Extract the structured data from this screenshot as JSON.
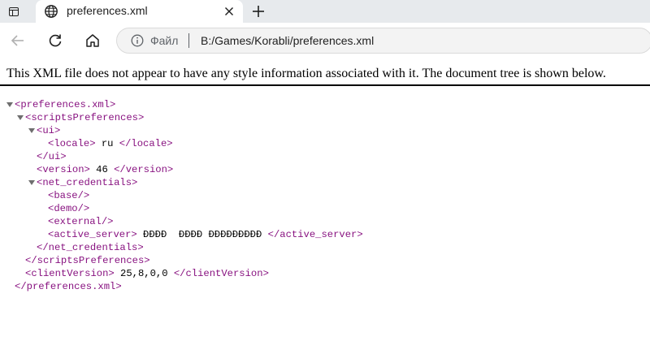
{
  "browser": {
    "tab": {
      "title": "preferences.xml",
      "icon": "globe-icon"
    },
    "toolbar": {
      "back_icon": "back-arrow-icon",
      "reload_icon": "reload-icon",
      "home_icon": "home-icon",
      "info_icon": "info-icon",
      "address_scheme_label": "Файл",
      "address_separator": "|",
      "address_url": "B:/Games/Korabli/preferences.xml"
    }
  },
  "xml_viewer": {
    "info_message": "This XML file does not appear to have any style information associated with it. The document tree is shown below.",
    "tree": {
      "root_open": "<preferences.xml>",
      "scripts_open": "<scriptsPreferences>",
      "ui_open": "<ui>",
      "locale_open": "<locale>",
      "locale_value": " ru ",
      "locale_close": "</locale>",
      "ui_close": "</ui>",
      "version_open": "<version>",
      "version_value": " 46 ",
      "version_close": "</version>",
      "net_open": "<net_credentials>",
      "base_tag": "<base/>",
      "demo_tag": "<demo/>",
      "external_tag": "<external/>",
      "active_open": "<active_server>",
      "active_value": " ÐÐÐÐ  ÐÐÐÐ ÐÐÐÐÐÐÐÐÐ ",
      "active_close": "</active_server>",
      "net_close": "</net_credentials>",
      "scripts_close": "</scriptsPreferences>",
      "client_open": "<clientVersion>",
      "client_value": " 25,8,0,0 ",
      "client_close": "</clientVersion>",
      "root_close": "</preferences.xml>"
    }
  }
}
